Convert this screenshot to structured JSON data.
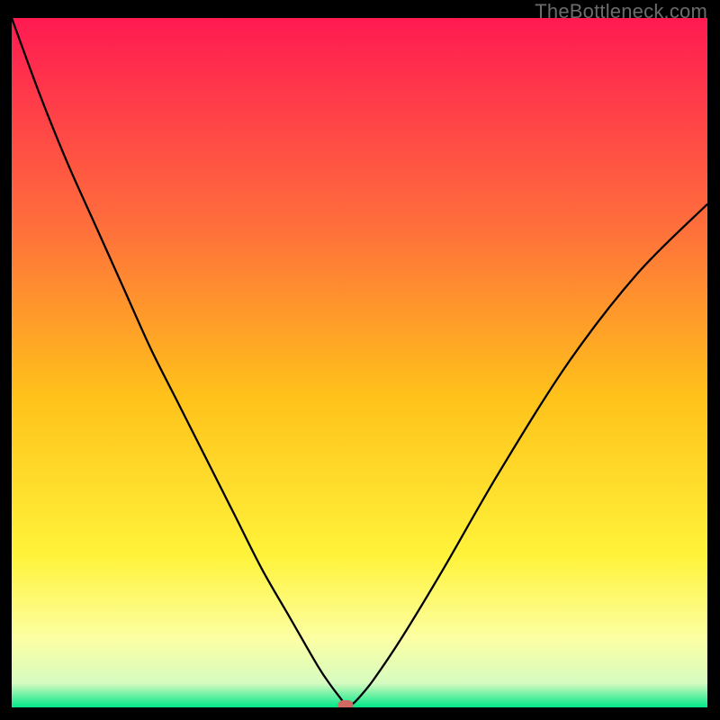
{
  "watermark": "TheBottleneck.com",
  "chart_data": {
    "type": "line",
    "title": "",
    "xlabel": "",
    "ylabel": "",
    "xlim": [
      0,
      100
    ],
    "ylim": [
      0,
      100
    ],
    "grid": false,
    "legend": false,
    "background_gradient": {
      "direction": "vertical",
      "stops": [
        {
          "pos": 0.0,
          "color": "#ff1a52"
        },
        {
          "pos": 0.3,
          "color": "#ff6e3c"
        },
        {
          "pos": 0.55,
          "color": "#ffc21a"
        },
        {
          "pos": 0.78,
          "color": "#fff33a"
        },
        {
          "pos": 0.9,
          "color": "#fcffa3"
        },
        {
          "pos": 0.965,
          "color": "#d6fbc0"
        },
        {
          "pos": 1.0,
          "color": "#00e789"
        }
      ]
    },
    "series": [
      {
        "name": "bottleneck-curve",
        "color": "#000000",
        "x": [
          0,
          4,
          8,
          12,
          16,
          20,
          24,
          28,
          32,
          36,
          40,
          44,
          46,
          47.5,
          48,
          49,
          50,
          52,
          56,
          62,
          70,
          80,
          90,
          100
        ],
        "y": [
          100,
          89,
          79,
          70,
          61,
          52,
          44,
          36,
          28,
          20,
          13,
          6,
          3,
          1,
          0,
          0.5,
          1.5,
          4,
          10,
          20,
          34,
          50,
          63,
          73
        ]
      }
    ],
    "marker": {
      "name": "optimal-point",
      "x": 48,
      "y": 0,
      "color": "#d06a63",
      "shape": "rounded-pill"
    }
  }
}
